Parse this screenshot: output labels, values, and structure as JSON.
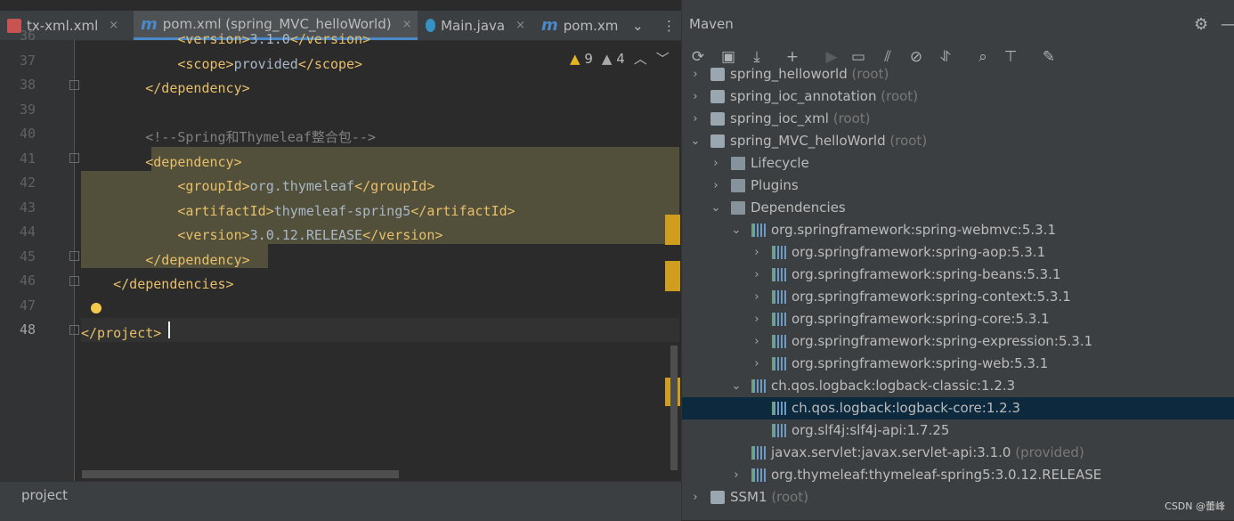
{
  "editor": {
    "tabs": [
      {
        "label": "tx-xml.xml",
        "icon": "xml-file-icon"
      },
      {
        "label": "pom.xml (spring_MVC_helloWorld)",
        "icon": "maven-m-icon",
        "active": true
      },
      {
        "label": "Main.java",
        "icon": "java-class-icon"
      },
      {
        "label": "pom.xm",
        "icon": "maven-m-icon"
      }
    ],
    "close_glyph": "×",
    "more_glyph": "⋮",
    "overflow_glyph": "⌄",
    "warnings": {
      "count": "9",
      "weak_count": "4"
    },
    "line_numbers": [
      "36",
      "37",
      "38",
      "39",
      "40",
      "41",
      "42",
      "43",
      "44",
      "45",
      "46",
      "47",
      "48"
    ],
    "lines": [
      {
        "indent": "            ",
        "parts": [
          {
            "t": "<version>",
            "c": "tag"
          },
          {
            "t": "3.1.0",
            "c": "txt"
          },
          {
            "t": "</version>",
            "c": "tag"
          }
        ]
      },
      {
        "indent": "            ",
        "parts": [
          {
            "t": "<scope>",
            "c": "tag"
          },
          {
            "t": "provided",
            "c": "txt"
          },
          {
            "t": "</scope>",
            "c": "tag"
          }
        ]
      },
      {
        "indent": "        ",
        "parts": [
          {
            "t": "</dependency>",
            "c": "tag"
          }
        ]
      },
      {
        "indent": "",
        "parts": []
      },
      {
        "indent": "        ",
        "parts": [
          {
            "t": "<!--Spring和Thymeleaf整合包-->",
            "c": "cmt"
          }
        ]
      },
      {
        "indent": "        ",
        "parts": [
          {
            "t": "<dependency>",
            "c": "tag"
          }
        ]
      },
      {
        "indent": "            ",
        "parts": [
          {
            "t": "<groupId>",
            "c": "tag"
          },
          {
            "t": "org.thymeleaf",
            "c": "txt"
          },
          {
            "t": "</groupId>",
            "c": "tag"
          }
        ]
      },
      {
        "indent": "            ",
        "parts": [
          {
            "t": "<artifactId>",
            "c": "tag"
          },
          {
            "t": "thymeleaf-spring5",
            "c": "txt"
          },
          {
            "t": "</artifactId>",
            "c": "tag"
          }
        ]
      },
      {
        "indent": "            ",
        "parts": [
          {
            "t": "<version>",
            "c": "tag"
          },
          {
            "t": "3.0.12.RELEASE",
            "c": "txt"
          },
          {
            "t": "</version>",
            "c": "tag"
          }
        ]
      },
      {
        "indent": "        ",
        "parts": [
          {
            "t": "</dependency>",
            "c": "tag"
          }
        ]
      },
      {
        "indent": "    ",
        "parts": [
          {
            "t": "</dependencies>",
            "c": "tag"
          }
        ]
      },
      {
        "indent": "",
        "parts": []
      },
      {
        "indent": "",
        "parts": [
          {
            "t": "</project>",
            "c": "tag"
          }
        ]
      }
    ],
    "breadcrumb": "project"
  },
  "maven": {
    "title": "Maven",
    "settings_icon": "gear-icon",
    "minimize_icon": "minimize-icon",
    "tree": [
      {
        "level": 0,
        "arrow": "›",
        "icon": "maven-module-icon",
        "label": "spring_helloworld",
        "note": "(root)"
      },
      {
        "level": 0,
        "arrow": "›",
        "icon": "maven-module-icon",
        "label": "spring_ioc_annotation",
        "note": "(root)"
      },
      {
        "level": 0,
        "arrow": "›",
        "icon": "maven-module-icon",
        "label": "spring_ioc_xml",
        "note": "(root)"
      },
      {
        "level": 0,
        "arrow": "⌄",
        "icon": "maven-module-icon",
        "label": "spring_MVC_helloWorld",
        "note": "(root)"
      },
      {
        "level": 1,
        "arrow": "›",
        "icon": "lifecycle-folder-icon",
        "label": "Lifecycle",
        "note": ""
      },
      {
        "level": 1,
        "arrow": "›",
        "icon": "plugins-folder-icon",
        "label": "Plugins",
        "note": ""
      },
      {
        "level": 1,
        "arrow": "⌄",
        "icon": "dependencies-folder-icon",
        "label": "Dependencies",
        "note": ""
      },
      {
        "level": 2,
        "arrow": "⌄",
        "icon": "library-icon",
        "label": "org.springframework:spring-webmvc:5.3.1",
        "note": ""
      },
      {
        "level": 3,
        "arrow": "›",
        "icon": "library-icon",
        "label": "org.springframework:spring-aop:5.3.1",
        "note": ""
      },
      {
        "level": 3,
        "arrow": "›",
        "icon": "library-icon",
        "label": "org.springframework:spring-beans:5.3.1",
        "note": ""
      },
      {
        "level": 3,
        "arrow": "›",
        "icon": "library-icon",
        "label": "org.springframework:spring-context:5.3.1",
        "note": ""
      },
      {
        "level": 3,
        "arrow": "›",
        "icon": "library-icon",
        "label": "org.springframework:spring-core:5.3.1",
        "note": ""
      },
      {
        "level": 3,
        "arrow": "›",
        "icon": "library-icon",
        "label": "org.springframework:spring-expression:5.3.1",
        "note": ""
      },
      {
        "level": 3,
        "arrow": "›",
        "icon": "library-icon",
        "label": "org.springframework:spring-web:5.3.1",
        "note": ""
      },
      {
        "level": 2,
        "arrow": "⌄",
        "icon": "library-icon",
        "label": "ch.qos.logback:logback-classic:1.2.3",
        "note": ""
      },
      {
        "level": 3,
        "arrow": "",
        "icon": "library-icon",
        "label": "ch.qos.logback:logback-core:1.2.3",
        "note": "",
        "selected": true
      },
      {
        "level": 3,
        "arrow": "",
        "icon": "library-icon",
        "label": "org.slf4j:slf4j-api:1.7.25",
        "note": ""
      },
      {
        "level": 2,
        "arrow": "",
        "icon": "library-icon",
        "label": "javax.servlet:javax.servlet-api:3.1.0",
        "note": "(provided)"
      },
      {
        "level": 2,
        "arrow": "›",
        "icon": "library-icon",
        "label": "org.thymeleaf:thymeleaf-spring5:3.0.12.RELEASE",
        "note": ""
      },
      {
        "level": 0,
        "arrow": "›",
        "icon": "maven-module-icon",
        "label": "SSM1",
        "note": "(root)"
      }
    ]
  },
  "watermark": "CSDN @蕾峰",
  "colors": {
    "tag": "#e8bf6a",
    "text": "#a9b7c6",
    "comment": "#808080",
    "accent": "#4a88c7",
    "warning": "#e6b422"
  }
}
